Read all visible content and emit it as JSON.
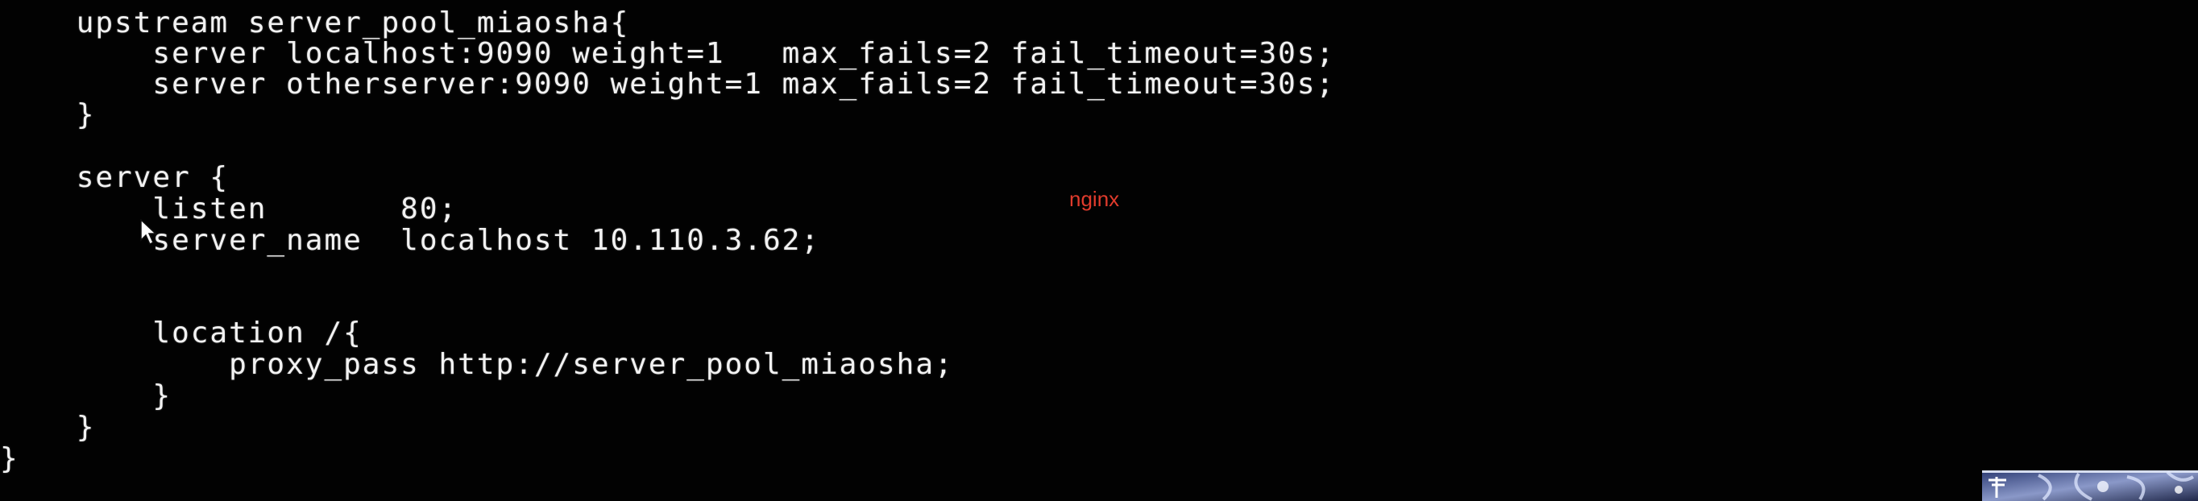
{
  "terminal": {
    "lines": [
      "    upstream server_pool_miaosha{",
      "        server localhost:9090 weight=1   max_fails=2 fail_timeout=30s;",
      "        server otherserver:9090 weight=1 max_fails=2 fail_timeout=30s;",
      "    }",
      "",
      "    server {",
      "        listen       80;",
      "        server_name  localhost 10.110.3.62;",
      "",
      "",
      "        location /{",
      "            proxy_pass http://server_pool_miaosha;",
      "        }",
      "    }",
      "}"
    ]
  },
  "overlay": {
    "label": "nginx",
    "label_color": "#e03b2c"
  },
  "icons": {
    "cursor": "mouse-pointer-icon",
    "corner": "desktop-wallpaper-thumbnail"
  }
}
